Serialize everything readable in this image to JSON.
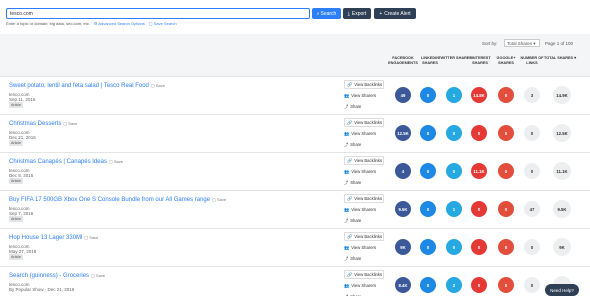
{
  "search": {
    "value": "tesco.com",
    "button_label": "Search"
  },
  "toolbar": {
    "export_label": "Export",
    "alert_label": "Create Alert"
  },
  "hint": {
    "text": "Enter a topic or domain; big data, seo.com, etc.",
    "advanced": "Advanced Search Options",
    "save": "Save Search"
  },
  "sort": {
    "label": "Sort by:",
    "value": "Total Shares ▾",
    "page": "Page 1 of 100"
  },
  "columns": [
    "FACEBOOK ENGAGEMENTS",
    "LINKEDIN SHARES",
    "TWITTER SHARES",
    "PINTEREST SHARES",
    "GOOGLE+ SHARES",
    "NUMBER OF LINKS",
    "TOTAL SHARES ▾"
  ],
  "action_labels": {
    "backlinks": "View Backlinks",
    "sharers": "View Sharers",
    "share": "Share"
  },
  "rows": [
    {
      "title": "Sweet potato, lentil and feta salad | Tesco Real Food",
      "save": "Save",
      "domain": "tesco.com",
      "date": "Sep 11, 2016",
      "badge": "Article",
      "fb": "49",
      "li": "0",
      "tw": "1",
      "pi": "14.8K",
      "gp": "0",
      "links": "3",
      "total": "14.9K"
    },
    {
      "title": "Christmas Desserts",
      "save": "Save",
      "domain": "tesco.com",
      "date": "Dec 21, 2016",
      "badge": "Article",
      "fb": "12.5K",
      "li": "0",
      "tw": "0",
      "pi": "0",
      "gp": "0",
      "links": "0",
      "total": "12.5K"
    },
    {
      "title": "Christmas Canapés | Canapés Ideas",
      "save": "Save",
      "domain": "tesco.com",
      "date": "Dec 8, 2016",
      "badge": "Article",
      "fb": "4",
      "li": "0",
      "tw": "0",
      "pi": "11.1K",
      "gp": "0",
      "links": "0",
      "total": "11.1K"
    },
    {
      "title": "Buy FIFA 17 500GB Xbox One S Console Bundle from our All Games range",
      "save": "Save",
      "domain": "tesco.com",
      "date": "Sep 7, 2016",
      "badge": "Article",
      "fb": "9.5K",
      "li": "0",
      "tw": "1",
      "pi": "0",
      "gp": "0",
      "links": "47",
      "total": "9.5K"
    },
    {
      "title": "Hop House 13 Lager 330Ml",
      "save": "Save",
      "domain": "tesco.com",
      "date": "May 27, 2016",
      "badge": "Article",
      "fb": "9K",
      "li": "0",
      "tw": "0",
      "pi": "0",
      "gp": "0",
      "links": "0",
      "total": "9K"
    },
    {
      "title": "Search (guinness) - Groceries",
      "save": "Save",
      "domain": "tesco.com",
      "date": "By Popular Show - Dec 21, 2016",
      "badge": "",
      "fb": "8.4K",
      "li": "0",
      "tw": "2",
      "pi": "0",
      "gp": "0",
      "links": "0",
      "total": "8.4K"
    }
  ],
  "help_label": "Need Help?"
}
